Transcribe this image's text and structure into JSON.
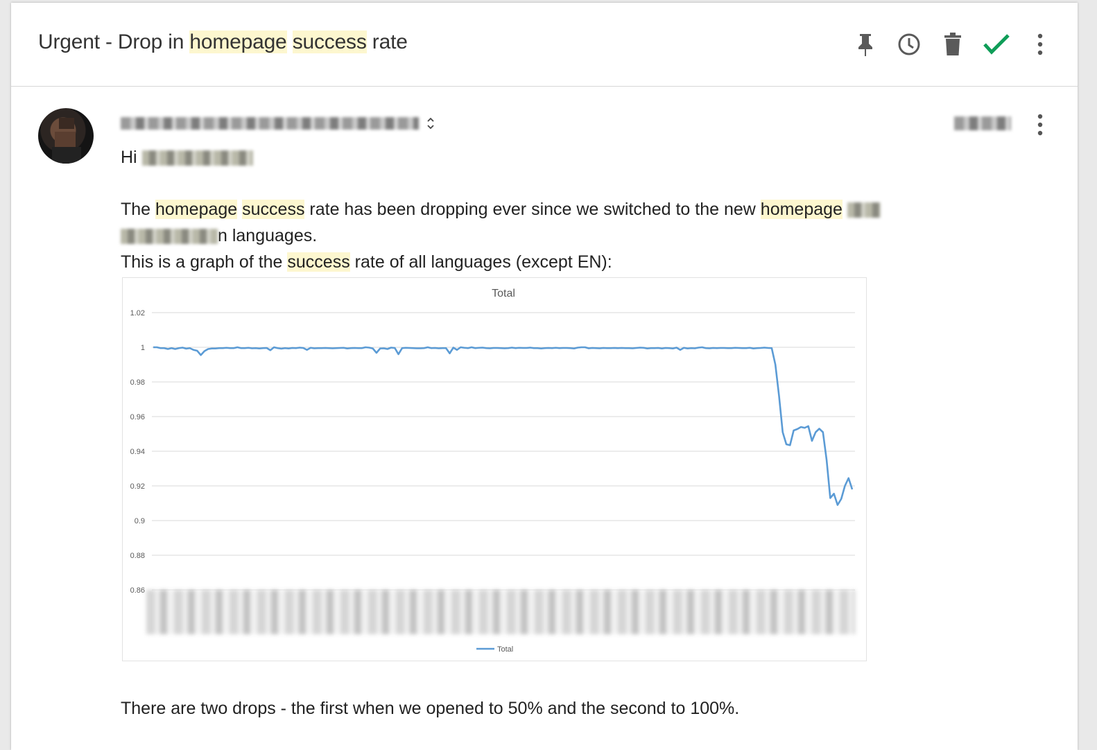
{
  "subject": {
    "prefix": "Urgent - Drop in ",
    "hl1": "homepage",
    "sp": " ",
    "hl2": "success",
    "suffix": " rate"
  },
  "toolbar": {
    "icons": [
      "pin-icon",
      "clock-icon",
      "trash-icon",
      "checkmark-icon",
      "more-vert-icon"
    ],
    "check_color": "#0f9d58"
  },
  "message": {
    "greeting": "Hi",
    "p1": {
      "a": "The ",
      "hl1": "homepage",
      "b": " ",
      "hl2": "success",
      "c": " rate has been dropping ever since we switched to the new ",
      "hl3": "homepage"
    },
    "p2": "n languages.",
    "p3": {
      "a": "This is a graph of the ",
      "hl": "success",
      "b": " rate of all languages (except EN):"
    },
    "closing": "There are two drops - the first when we opened to 50% and the second to 100%."
  },
  "chart_data": {
    "type": "line",
    "title": "Total",
    "legend": "Total",
    "legend_position": "bottom",
    "ylim": [
      0.86,
      1.02
    ],
    "yticks": [
      "1.02",
      "1",
      "0.98",
      "0.96",
      "0.94",
      "0.92",
      "0.9",
      "0.88",
      "0.86"
    ],
    "grid": true,
    "line_color": "#5b9bd5",
    "series": [
      {
        "name": "Total",
        "values": [
          1.0,
          1.0,
          0.9995,
          0.9995,
          0.999,
          0.9995,
          0.999,
          0.9995,
          0.9998,
          0.9992,
          0.9995,
          0.9985,
          0.998,
          0.9955,
          0.9978,
          0.999,
          0.9993,
          0.9993,
          0.9995,
          0.9995,
          0.9997,
          0.9995,
          0.9995,
          1.0,
          0.9995,
          0.9995,
          0.9997,
          0.9994,
          0.9995,
          0.9993,
          0.9995,
          0.9996,
          0.9983,
          1.0,
          0.9995,
          0.9992,
          0.9995,
          0.9993,
          0.9996,
          0.9995,
          0.9998,
          0.9996,
          0.9985,
          0.9997,
          0.9994,
          0.9995,
          0.9995,
          0.9996,
          0.9995,
          0.9994,
          0.9995,
          0.9996,
          0.9997,
          0.9993,
          0.9995,
          0.9996,
          0.9995,
          0.9995,
          1.0,
          0.9998,
          0.9993,
          0.9968,
          0.9993,
          0.9994,
          0.999,
          0.9998,
          0.9996,
          0.996,
          0.9995,
          0.9997,
          0.9996,
          0.9995,
          0.9994,
          0.9994,
          0.9995,
          1.0,
          0.9995,
          0.9996,
          0.9994,
          0.9995,
          0.9995,
          0.9965,
          0.9998,
          0.9985,
          1.0,
          0.9997,
          0.9995,
          1.0,
          0.9995,
          0.9997,
          0.9998,
          0.9995,
          0.9994,
          0.9996,
          0.9996,
          0.9995,
          0.9994,
          0.9995,
          0.9998,
          0.9995,
          0.9997,
          0.9996,
          0.9996,
          0.9998,
          0.9995,
          0.9995,
          0.9993,
          0.9995,
          0.9996,
          0.9995,
          0.9997,
          0.9995,
          0.9996,
          0.9996,
          0.9995,
          0.9993,
          0.9998,
          1.0,
          1.0,
          0.9994,
          0.9996,
          0.9995,
          0.9994,
          0.9996,
          0.9995,
          0.9995,
          0.9996,
          0.9995,
          0.9996,
          0.9995,
          0.9995,
          0.9994,
          0.9996,
          0.9998,
          0.9997,
          0.9993,
          0.9995,
          0.9995,
          0.9996,
          0.9993,
          0.9996,
          0.9995,
          0.9993,
          0.9998,
          0.9985,
          0.9997,
          0.9993,
          0.9995,
          0.9994,
          0.9998,
          1.0,
          0.9995,
          0.9994,
          0.9996,
          0.9995,
          0.9996,
          0.9996,
          0.9995,
          0.9995,
          0.9997,
          0.9996,
          0.9995,
          0.9995,
          0.9997,
          0.9993,
          0.9995,
          0.9996,
          0.9998,
          0.9996,
          0.9995,
          0.99,
          0.972,
          0.951,
          0.944,
          0.9435,
          0.952,
          0.9528,
          0.954,
          0.9535,
          0.9545,
          0.946,
          0.951,
          0.953,
          0.951,
          0.935,
          0.913,
          0.9155,
          0.909,
          0.9125,
          0.92,
          0.9245,
          0.918
        ]
      }
    ]
  }
}
